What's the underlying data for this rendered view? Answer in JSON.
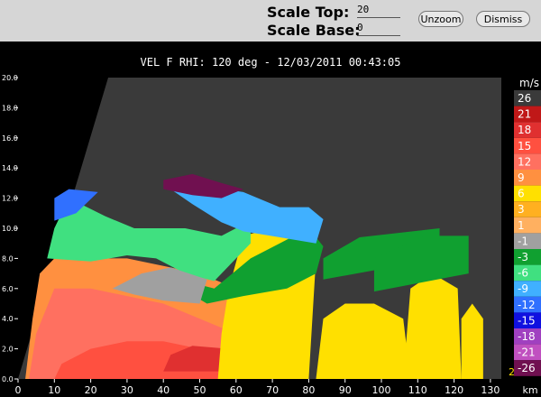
{
  "toolbar": {
    "scale_top_label": "Scale Top:",
    "scale_top_value": "20",
    "scale_base_label": "Scale Base:",
    "scale_base_value": "0",
    "unzoom_label": "Unzoom",
    "dismiss_label": "Dismiss"
  },
  "plot": {
    "title": "VEL F  RHI: 120 deg  -  12/03/2011 00:43:05",
    "corner_label": "2"
  },
  "colors": {
    "background": "#3a3a3a",
    "no_data": "#000000"
  },
  "chart_data": {
    "type": "heatmap",
    "title": "VEL F  RHI: 120 deg  -  12/03/2011 00:43:05",
    "xlabel": "km",
    "ylabel": "",
    "xlim": [
      0,
      133
    ],
    "ylim": [
      0,
      20
    ],
    "x_ticks": [
      "0",
      "10",
      "20",
      "30",
      "40",
      "50",
      "60",
      "70",
      "80",
      "90",
      "100",
      "110",
      "120",
      "130"
    ],
    "y_ticks": [
      "0.0",
      "2.0",
      "4.0",
      "6.0",
      "8.0",
      "10.0",
      "12.0",
      "14.0",
      "16.0",
      "18.0",
      "20.0"
    ],
    "legend_unit": "m/s",
    "legend": [
      {
        "label": "26",
        "color": "#3a3a3a"
      },
      {
        "label": "21",
        "color": "#c01818"
      },
      {
        "label": "18",
        "color": "#e03030"
      },
      {
        "label": "15",
        "color": "#ff5040"
      },
      {
        "label": "12",
        "color": "#ff7060"
      },
      {
        "label": "9",
        "color": "#ff9040"
      },
      {
        "label": "6",
        "color": "#ffe000"
      },
      {
        "label": "3",
        "color": "#ffb020"
      },
      {
        "label": "1",
        "color": "#ffb060"
      },
      {
        "label": "-1",
        "color": "#a0a0a0"
      },
      {
        "label": "-3",
        "color": "#10a030"
      },
      {
        "label": "-6",
        "color": "#40e080"
      },
      {
        "label": "-9",
        "color": "#40b0ff"
      },
      {
        "label": "-12",
        "color": "#3070ff"
      },
      {
        "label": "-15",
        "color": "#1010e0"
      },
      {
        "label": "-18",
        "color": "#a040c0"
      },
      {
        "label": "-21",
        "color": "#c050c0"
      },
      {
        "label": "-26",
        "color": "#701050"
      }
    ]
  }
}
